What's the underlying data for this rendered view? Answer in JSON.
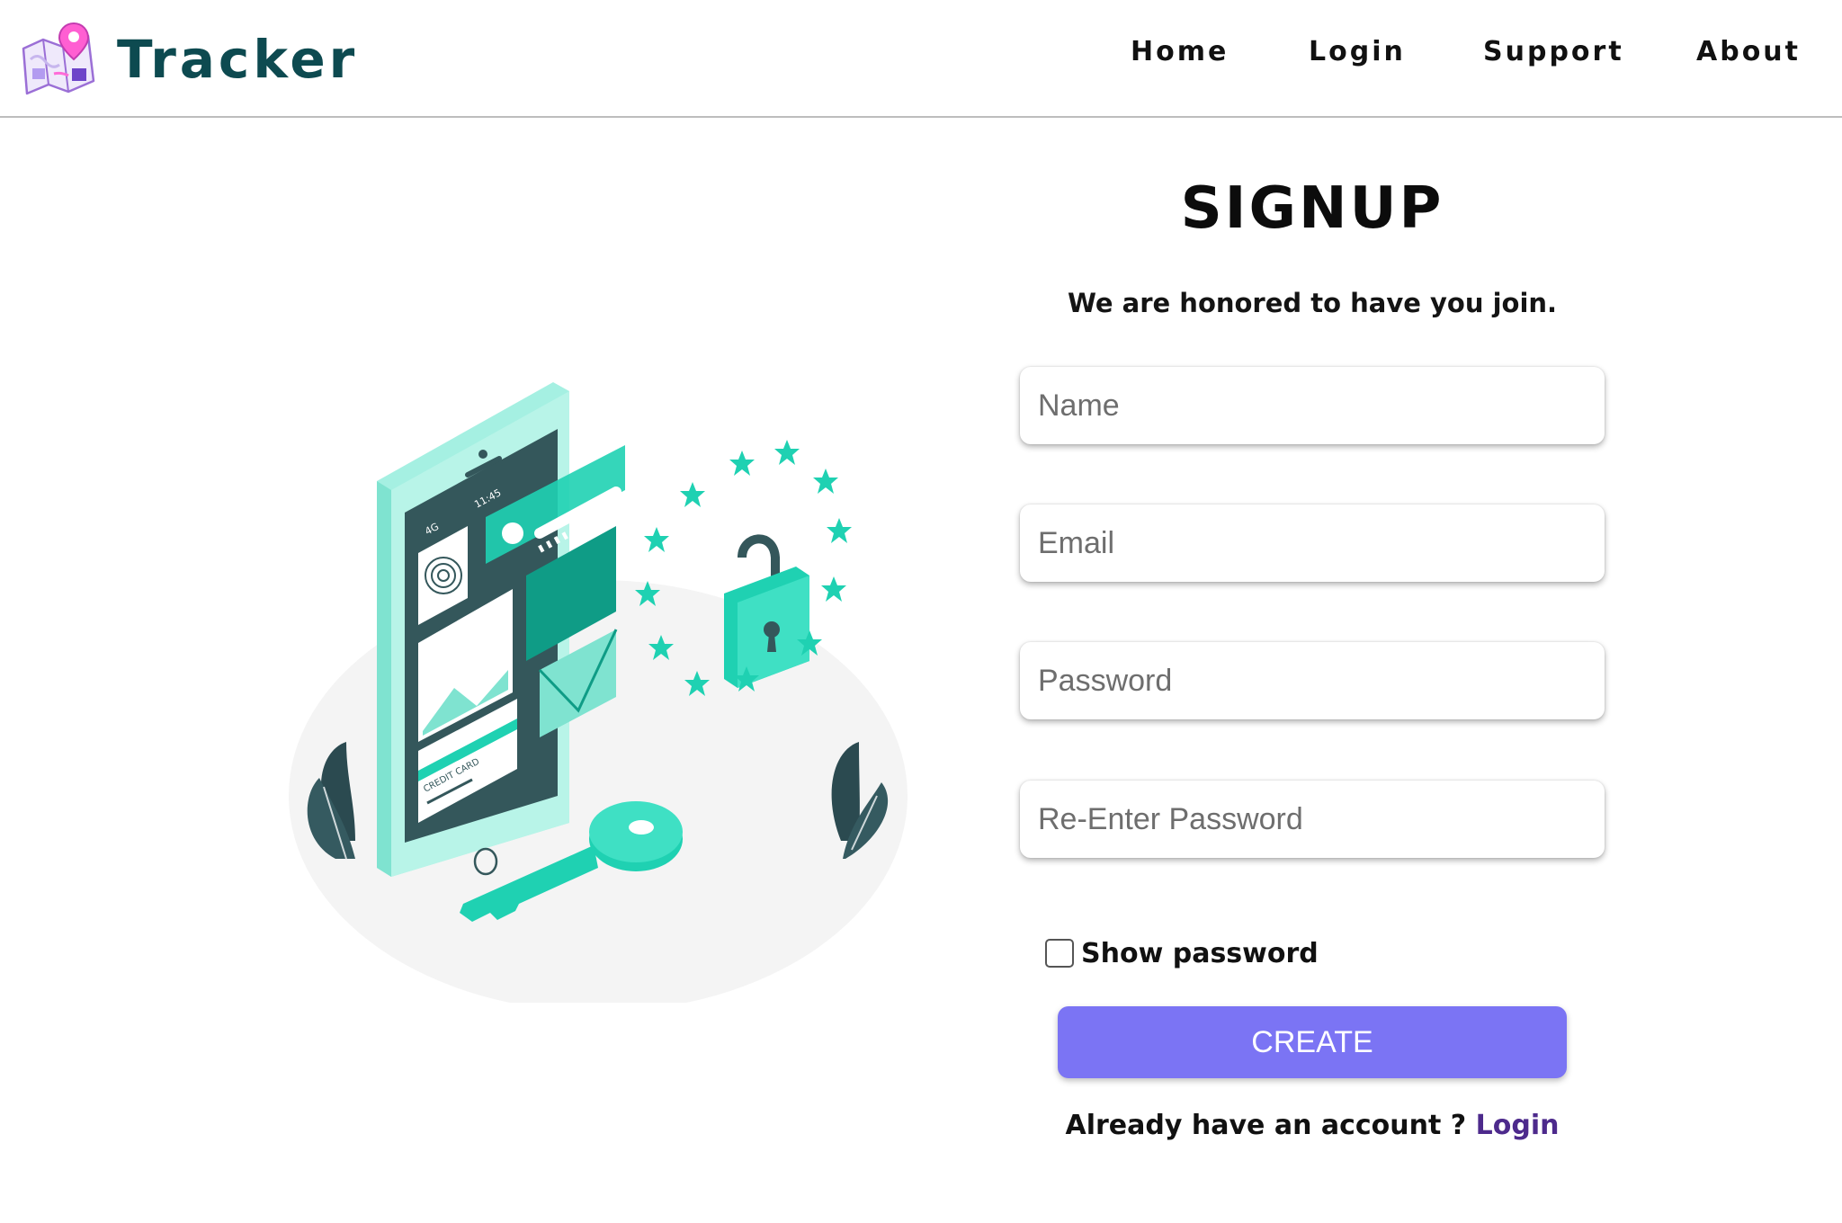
{
  "brand": {
    "title": "Tracker",
    "logo_icon": "map-pin-icon"
  },
  "nav": {
    "items": [
      "Home",
      "Login",
      "Support",
      "About"
    ]
  },
  "signup": {
    "title": "SIGNUP",
    "subtitle": "We are honored to have you join.",
    "fields": [
      {
        "placeholder": "Name",
        "value": ""
      },
      {
        "placeholder": "Email",
        "value": ""
      },
      {
        "placeholder": "Password",
        "value": ""
      },
      {
        "placeholder": "Re-Enter Password",
        "value": ""
      }
    ],
    "show_password": {
      "label": "Show password",
      "checked": false
    },
    "create_button": "CREATE",
    "already": {
      "text": "Already have an account ? ",
      "link": "Login"
    }
  },
  "illustration": {
    "icon": "phone-security-illustration",
    "phone_time": "11:45",
    "card_label": "CREDIT CARD"
  },
  "colors": {
    "brand": "#0d4a50",
    "accent": "#7b74f4",
    "link": "#4d2a8c",
    "teal": "#1fd1b2"
  }
}
